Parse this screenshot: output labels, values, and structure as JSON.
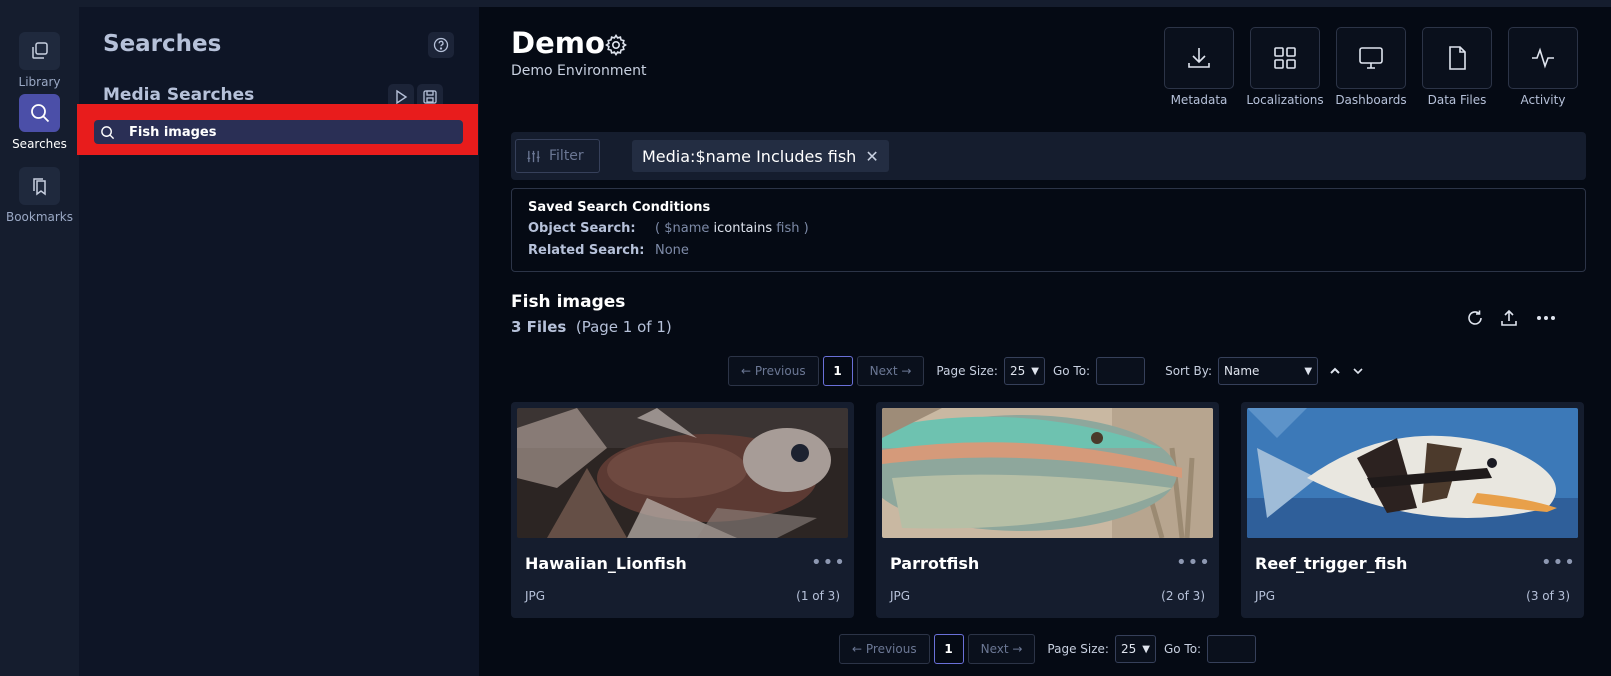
{
  "rail": {
    "items": [
      {
        "label": "Library",
        "icon": "library-icon"
      },
      {
        "label": "Searches",
        "icon": "search-icon"
      },
      {
        "label": "Bookmarks",
        "icon": "bookmark-icon"
      }
    ]
  },
  "panel": {
    "title": "Searches",
    "subtitle": "Media Searches",
    "search_items": [
      {
        "label": "Fish images"
      }
    ]
  },
  "header": {
    "title": "Demo",
    "subtitle": "Demo Environment",
    "tools": [
      {
        "label": "Metadata",
        "icon": "download-icon"
      },
      {
        "label": "Localizations",
        "icon": "grid-icon"
      },
      {
        "label": "Dashboards",
        "icon": "monitor-icon"
      },
      {
        "label": "Data Files",
        "icon": "file-icon"
      },
      {
        "label": "Activity",
        "icon": "activity-icon"
      }
    ]
  },
  "filter": {
    "button_label": "Filter",
    "chip_label": "Media:$name Includes fish",
    "chip_close": "✕"
  },
  "conditions": {
    "title": "Saved Search Conditions",
    "object_label": "Object Search:",
    "object_open": "(",
    "object_field": "$name",
    "object_op": "icontains",
    "object_value": "fish",
    "object_close": ")",
    "related_label": "Related Search:",
    "related_value": "None"
  },
  "section": {
    "title": "Fish images",
    "count": "3 Files",
    "page_info": "(Page 1 of 1)"
  },
  "pagination": {
    "previous": "← Previous",
    "next": "Next →",
    "current_page": "1",
    "page_size_label": "Page Size:",
    "page_size": "25",
    "goto_label": "Go To:",
    "sort_label": "Sort By:",
    "sort_value": "Name"
  },
  "cards": [
    {
      "name": "Hawaiian_Lionfish",
      "type": "JPG",
      "position": "(1 of 3)"
    },
    {
      "name": "Parrotfish",
      "type": "JPG",
      "position": "(2 of 3)"
    },
    {
      "name": "Reef_trigger_fish",
      "type": "JPG",
      "position": "(3 of 3)"
    }
  ],
  "colors": {
    "accent": "#4b4fa8",
    "highlight": "#e81c1c",
    "background": "#050a14"
  }
}
